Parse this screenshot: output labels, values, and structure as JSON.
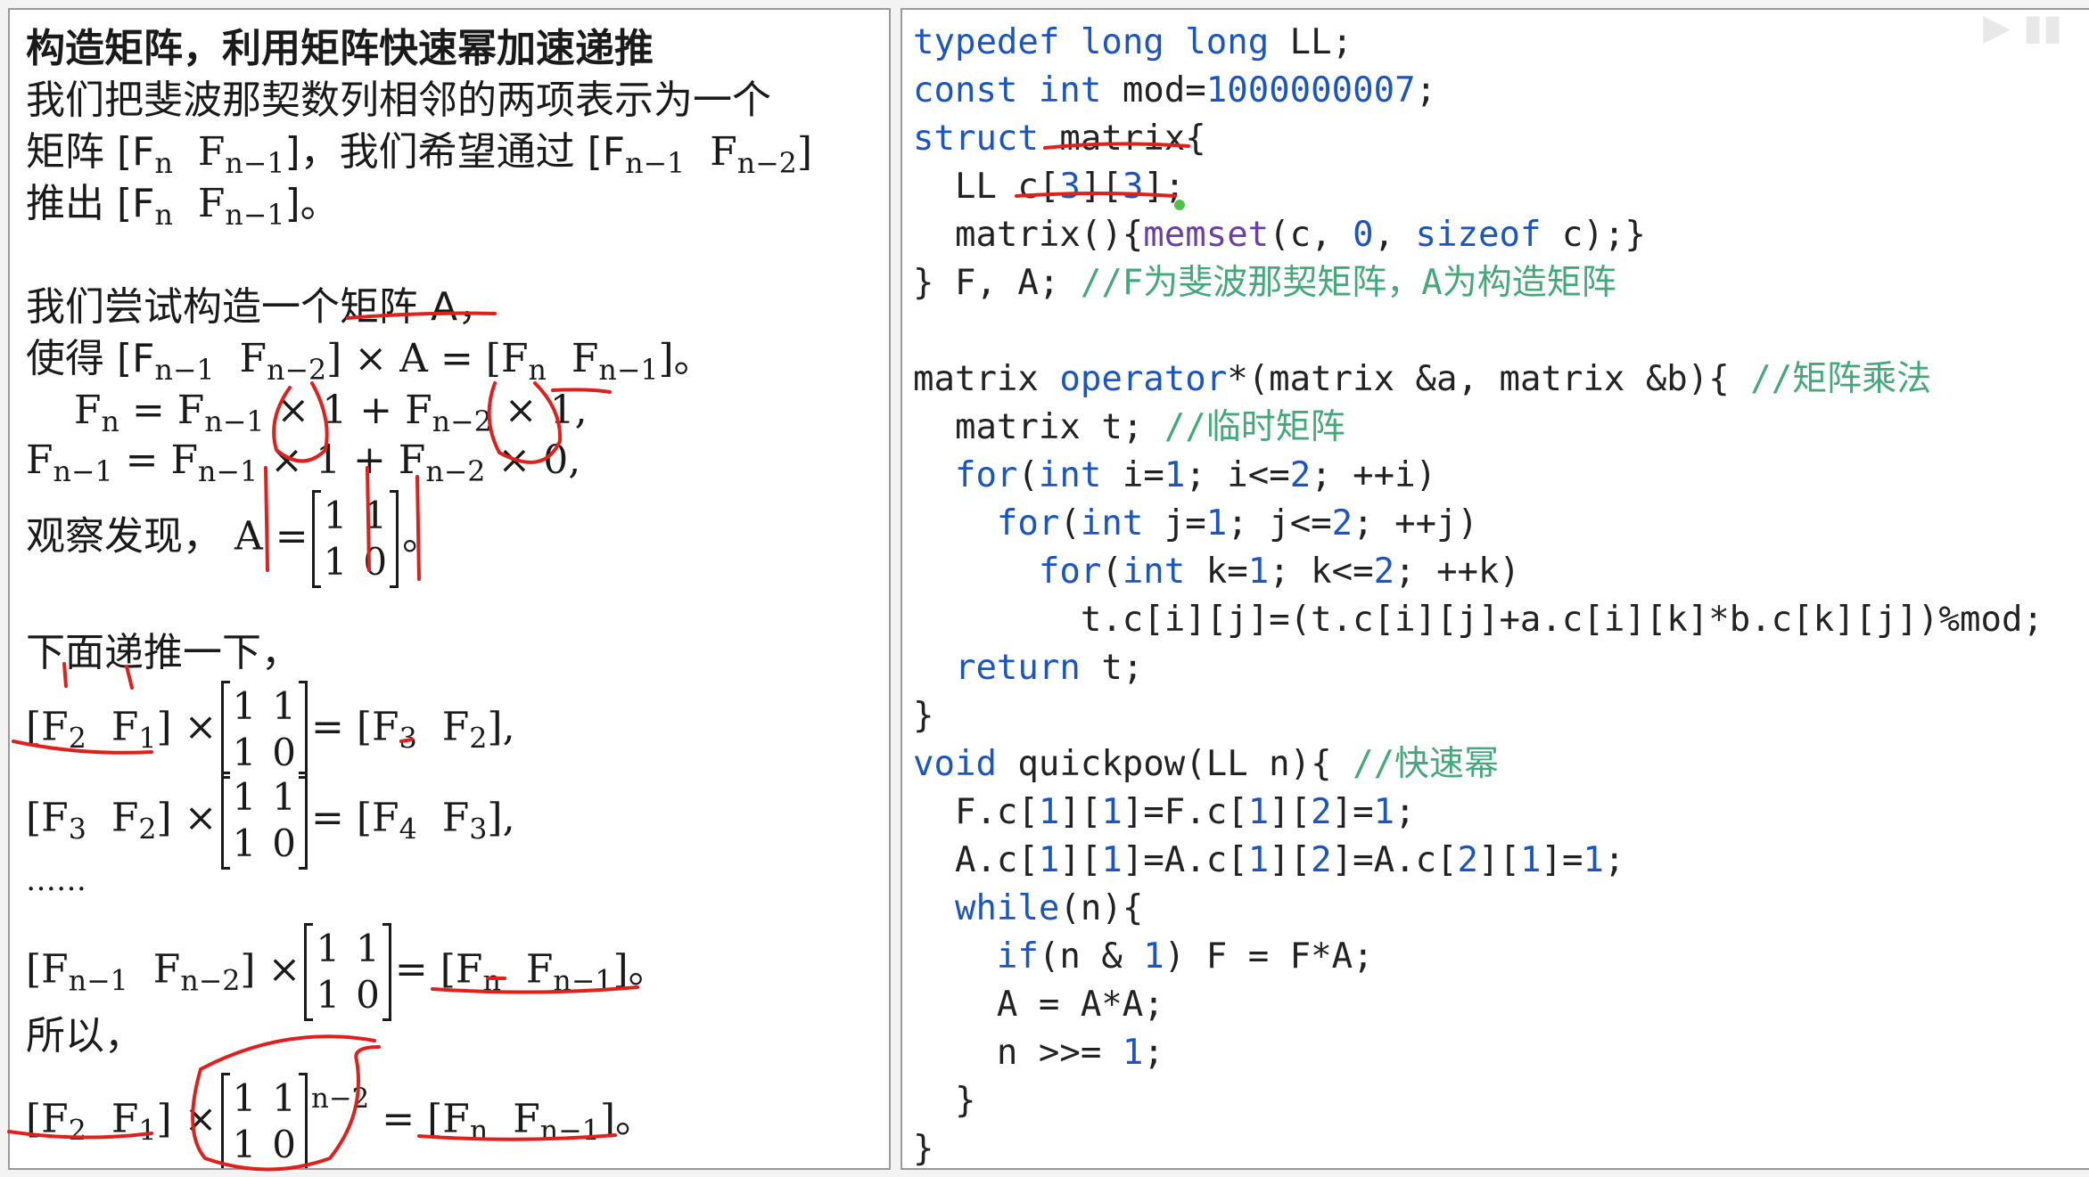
{
  "left": {
    "title": "构造矩阵，利用矩阵快速幂加速递推",
    "p1": "我们把斐波那契数列相邻的两项表示为一个",
    "p2_a": "矩阵 [F",
    "p2_b": "F",
    "p2_c": "]，我们希望通过 [F",
    "p2_d": "F",
    "p3_a": "推出 [F",
    "p3_b": "F",
    "p3_c": "]。",
    "try_line": "我们尝试构造一个矩阵 A，",
    "make_a": "使得 [F",
    "make_b": "F",
    "make_c": "] × A = [F",
    "make_d": "F",
    "make_e": "]。",
    "eq1": "= F",
    "eq1_b": "× 1 + F",
    "eq1_c": "× 1,",
    "eq2": "= F",
    "eq2_b": "× 1 + F",
    "eq2_c": "× 0,",
    "observe": "观察发现，",
    "observe_a": "A =",
    "period": "。",
    "next": "下面递推一下，",
    "dots": "……",
    "so": "所以，",
    "matrix_11": [
      "1",
      "1",
      "1",
      "0"
    ],
    "exponent": "n−2",
    "subs": {
      "n": "n",
      "n1": "n−1",
      "n2": "n−2",
      "one": "1",
      "two": "2",
      "three": "3",
      "four": "4"
    }
  },
  "code": {
    "lines": [
      "typedef long long LL;",
      "const int mod=1000000007;",
      "struct matrix{",
      "  LL c[3][3];",
      "  matrix(){memset(c, 0, sizeof c);}",
      "} F, A; //F为斐波那契矩阵，A为构造矩阵",
      "",
      "matrix operator*(matrix &a, matrix &b){ //矩阵乘法",
      "  matrix t; //临时矩阵",
      "  for(int i=1; i<=2; ++i)",
      "    for(int j=1; j<=2; ++j)",
      "      for(int k=1; k<=2; ++k)",
      "        t.c[i][j]=(t.c[i][j]+a.c[i][k]*b.c[k][j])%mod;",
      "  return t;",
      "}",
      "void quickpow(LL n){ //快速幂",
      "  F.c[1][1]=F.c[1][2]=1;",
      "  A.c[1][1]=A.c[1][2]=A.c[2][1]=1;",
      "  while(n){",
      "    if(n & 1) F = F*A;",
      "    A = A*A;",
      "    n >>= 1;",
      "  }",
      "}"
    ]
  },
  "colors": {
    "annotation": "#e0201c",
    "keyword": "#1b55c2",
    "comment": "#44a87a"
  }
}
